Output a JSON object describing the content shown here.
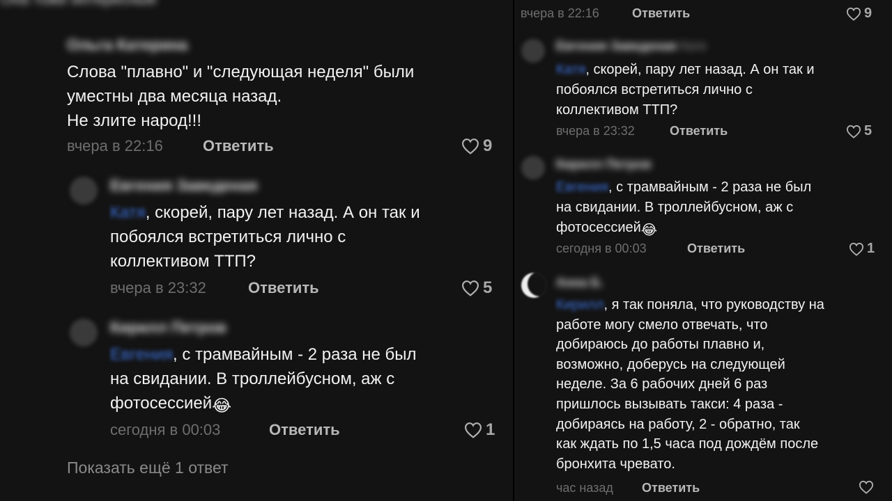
{
  "left": {
    "top_cut_text": "Она тоже интересные",
    "comment1": {
      "author": "Ольга Катерина",
      "lines": [
        "Слова \"плавно\" и \"следующая неделя\" были",
        "уместны два месяца назад.",
        "Не злите народ!!!"
      ],
      "time": "вчера в 22:16",
      "reply_label": "Ответить",
      "likes": "9"
    },
    "comment2": {
      "author": "Евгения Заведеная",
      "mention": "Катя",
      "lines": [
        ", скорей, пару лет назад. А он так и",
        "побоялся встретиться лично с",
        "коллективом ТТП?"
      ],
      "time": "вчера в 23:32",
      "reply_label": "Ответить",
      "likes": "5"
    },
    "comment3": {
      "author": "Кирилл Петров",
      "mention": "Евгения",
      "lines": [
        ", с трамвайным - 2 раза не был",
        "на свидании. В троллейбусном, аж с",
        "фотосессией"
      ],
      "emoji": "😂",
      "time": "сегодня в 00:03",
      "reply_label": "Ответить",
      "likes": "1"
    },
    "show_more": "Показать ещё 1 ответ"
  },
  "right": {
    "top": {
      "time": "вчера в 22:16",
      "reply_label": "Ответить",
      "likes": "9"
    },
    "comment2": {
      "author": "Евгения Заведеная",
      "author_suffix": "Кате",
      "mention": "Катя",
      "lines": [
        ", скорей, пару лет назад. А он так и",
        "побоялся встретиться лично с",
        "коллективом ТТП?"
      ],
      "time": "вчера в 23:32",
      "reply_label": "Ответить",
      "likes": "5"
    },
    "comment3": {
      "author": "Кирилл Петров",
      "mention": "Евгения",
      "lines": [
        ", с трамвайным - 2 раза не был",
        "на свидании. В троллейбусном, аж с",
        "фотосессией"
      ],
      "emoji": "😂",
      "time": "сегодня в 00:03",
      "reply_label": "Ответить",
      "likes": "1"
    },
    "comment4": {
      "author": "Анна Б.",
      "mention": "Кирилл",
      "lines": [
        ", я так поняла, что руководству на",
        "работе могу смело отвечать, что",
        "добираюсь до работы плавно и,",
        "возможно, доберусь на следующей",
        "неделе. За 6 рабочих дней  6 раз",
        "пришлось вызывать такси: 4 раза -",
        "добираясь на работу, 2 - обратно, так",
        "как ждать по 1,5 часа под дождём после",
        "бронхита чревато."
      ],
      "time": "час назад",
      "reply_label": "Ответить"
    }
  }
}
